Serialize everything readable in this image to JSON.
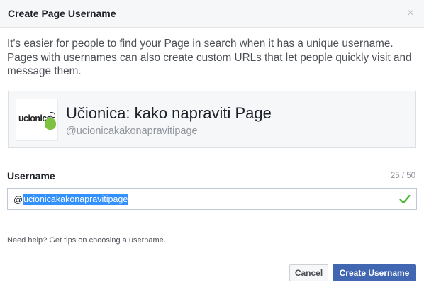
{
  "dialog": {
    "title": "Create Page Username",
    "close_glyph": "×"
  },
  "intro": {
    "text": "It's easier for people to find your Page in search when it has a unique username. Pages with usernames can also create custom URLs that let people quickly visit and message them."
  },
  "page_card": {
    "logo_text": "ucionica",
    "name": "Učionica: kako napraviti Page",
    "handle": "@ucionicakakonapravitipage"
  },
  "username": {
    "label": "Username",
    "char_count": "25 / 50",
    "prefix": "@",
    "value": "ucionicakakonapravitipage",
    "status_icon": "check-icon",
    "status_color": "#42b72a"
  },
  "help": {
    "text": "Need help? Get tips on choosing a username."
  },
  "buttons": {
    "cancel_label": "Cancel",
    "create_label": "Create Username"
  },
  "colors": {
    "primary": "#4267b2",
    "selection": "#3390ff"
  }
}
